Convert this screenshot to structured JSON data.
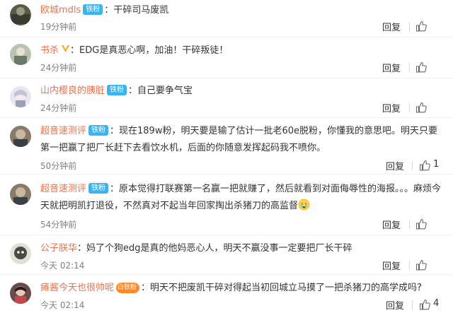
{
  "comments": [
    {
      "user": "欧城mdls",
      "badge": "铁粉",
      "text": "：干碎司马废凯",
      "time": "19分钟前",
      "reply": "回复",
      "likes": ""
    },
    {
      "user": "书杀",
      "badge": "",
      "text": "：EDG是真恶心啊，加油！干碎叛徒！",
      "time": "24分钟前",
      "reply": "回复",
      "likes": ""
    },
    {
      "user": "山内樱良的胰脏",
      "badge": "铁粉",
      "text": "：自己要争气宝",
      "time": "24分钟前",
      "reply": "回复",
      "likes": ""
    },
    {
      "user": "超音速测评",
      "badge": "铁粉",
      "text": "：现在189w粉，明天要是输了估计一批老60e脱粉，你懂我的意思吧。明天只要第一把赢了把厂长赶下去看饮水机，后面的你随意发挥起码我不喷你。",
      "time": "50分钟前",
      "reply": "回复",
      "likes": "1"
    },
    {
      "user": "超音速测评",
      "badge": "铁粉",
      "text": "：原本觉得打联赛第一名赢一把就赚了，然后就看到对面侮辱性的海报。。。麻烦今天就把明凯打退役，不然真对不起当年回家掏出杀猪刀的高监督",
      "time": "54分钟前",
      "reply": "回复",
      "likes": ""
    },
    {
      "user": "公子朕华",
      "badge": "",
      "text": "：妈了个狗edg是真的他妈恶心人，明天不赢没事一定要把厂长干碎",
      "time": "今天 02:14",
      "reply": "回复",
      "likes": ""
    },
    {
      "user": "瘫酱今天也很帅呢",
      "badge": "白铁粉",
      "text": "：明天不把废凯干碎对得起当初回城立马摸了一把杀猪刀的高学成吗?",
      "time": "今天 02:14",
      "reply": "回复",
      "likes": "4"
    }
  ]
}
